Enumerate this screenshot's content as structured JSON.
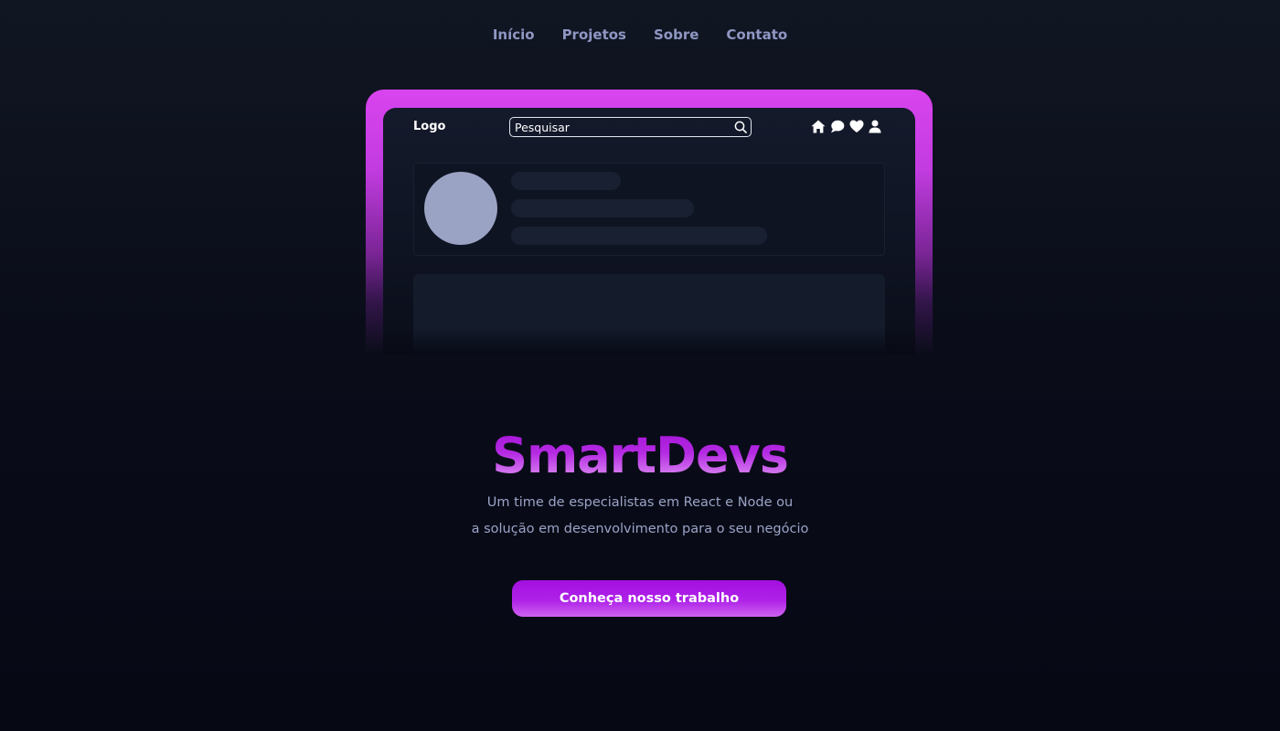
{
  "nav": {
    "items": [
      {
        "label": "Início"
      },
      {
        "label": "Projetos"
      },
      {
        "label": "Sobre"
      },
      {
        "label": "Contato"
      }
    ]
  },
  "mockup": {
    "logo": "Logo",
    "search_placeholder": "Pesquisar",
    "icons": [
      "home-icon",
      "chat-icon",
      "heart-icon",
      "user-icon"
    ]
  },
  "hero": {
    "title": "SmartDevs",
    "subtitle_line1": "Um time de especialistas em React e Node ou",
    "subtitle_line2": "a solução em desenvolvimento para o seu negócio",
    "cta_label": "Conheça nosso trabalho"
  },
  "colors": {
    "background": "#0a0d19",
    "accent": "#a40fdf",
    "frame": "#d944ef",
    "nav_text": "#8f97c3",
    "subtitle_text": "#9ba3c6"
  }
}
